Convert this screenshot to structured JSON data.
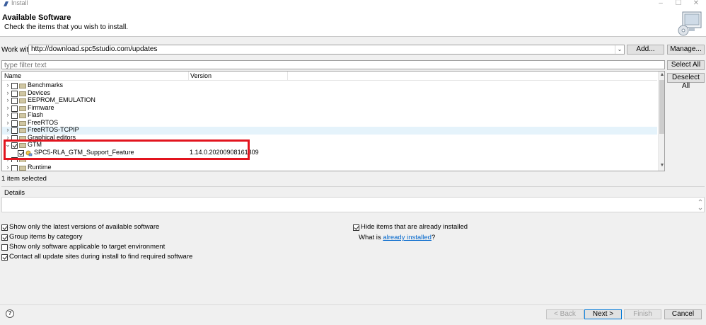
{
  "window": {
    "title": "Install",
    "app_icon": "eclipse-icon",
    "controls": {
      "minimize": "–",
      "maximize": "☐",
      "close": "✕"
    }
  },
  "banner": {
    "title": "Available Software",
    "subtitle": "Check the items that you wish to install.",
    "icon": "install-software-icon"
  },
  "work_with": {
    "label": "Work with:",
    "value": "http://download.spc5studio.com/updates",
    "add_button": "Add...",
    "manage_button": "Manage..."
  },
  "filter": {
    "placeholder": "type filter text",
    "select_all_button": "Select All",
    "deselect_all_button": "Deselect All"
  },
  "tree": {
    "columns": {
      "name": "Name",
      "version": "Version"
    },
    "rows": [
      {
        "name": "Benchmarks",
        "version": "",
        "checked": false,
        "expanded": false
      },
      {
        "name": "Devices",
        "version": "",
        "checked": false,
        "expanded": false
      },
      {
        "name": "EEPROM_EMULATION",
        "version": "",
        "checked": false,
        "expanded": false
      },
      {
        "name": "Firmware",
        "version": "",
        "checked": false,
        "expanded": false
      },
      {
        "name": "Flash",
        "version": "",
        "checked": false,
        "expanded": false
      },
      {
        "name": "FreeRTOS",
        "version": "",
        "checked": false,
        "expanded": false
      },
      {
        "name": "FreeRTOS-TCPIP",
        "version": "",
        "checked": false,
        "expanded": false
      },
      {
        "name": "Graphical editors",
        "version": "",
        "checked": false,
        "expanded": false
      },
      {
        "name": "GTM",
        "version": "",
        "checked": true,
        "expanded": true
      },
      {
        "name": "SPC5-RLA_GTM_Support_Feature",
        "version": "1.14.0.20200908161309",
        "checked": true,
        "child": true
      },
      {
        "name": "Runtime",
        "version": "",
        "checked": false,
        "expanded": false
      }
    ]
  },
  "status": "1 item selected",
  "details": {
    "label": "Details"
  },
  "options": {
    "latest_versions": {
      "label": "Show only the latest versions of available software",
      "checked": true
    },
    "group_by_category": {
      "label": "Group items by category",
      "checked": true
    },
    "target_env": {
      "label": "Show only software applicable to target environment",
      "checked": false
    },
    "contact_sites": {
      "label": "Contact all update sites during install to find required software",
      "checked": true
    },
    "hide_installed": {
      "label": "Hide items that are already installed",
      "checked": true
    },
    "what_is_prefix": "What is ",
    "what_is_link": "already installed",
    "what_is_suffix": "?"
  },
  "footer": {
    "back": "< Back",
    "next": "Next >",
    "finish": "Finish",
    "cancel": "Cancel",
    "help_icon": "help-icon",
    "help_glyph": "?"
  }
}
